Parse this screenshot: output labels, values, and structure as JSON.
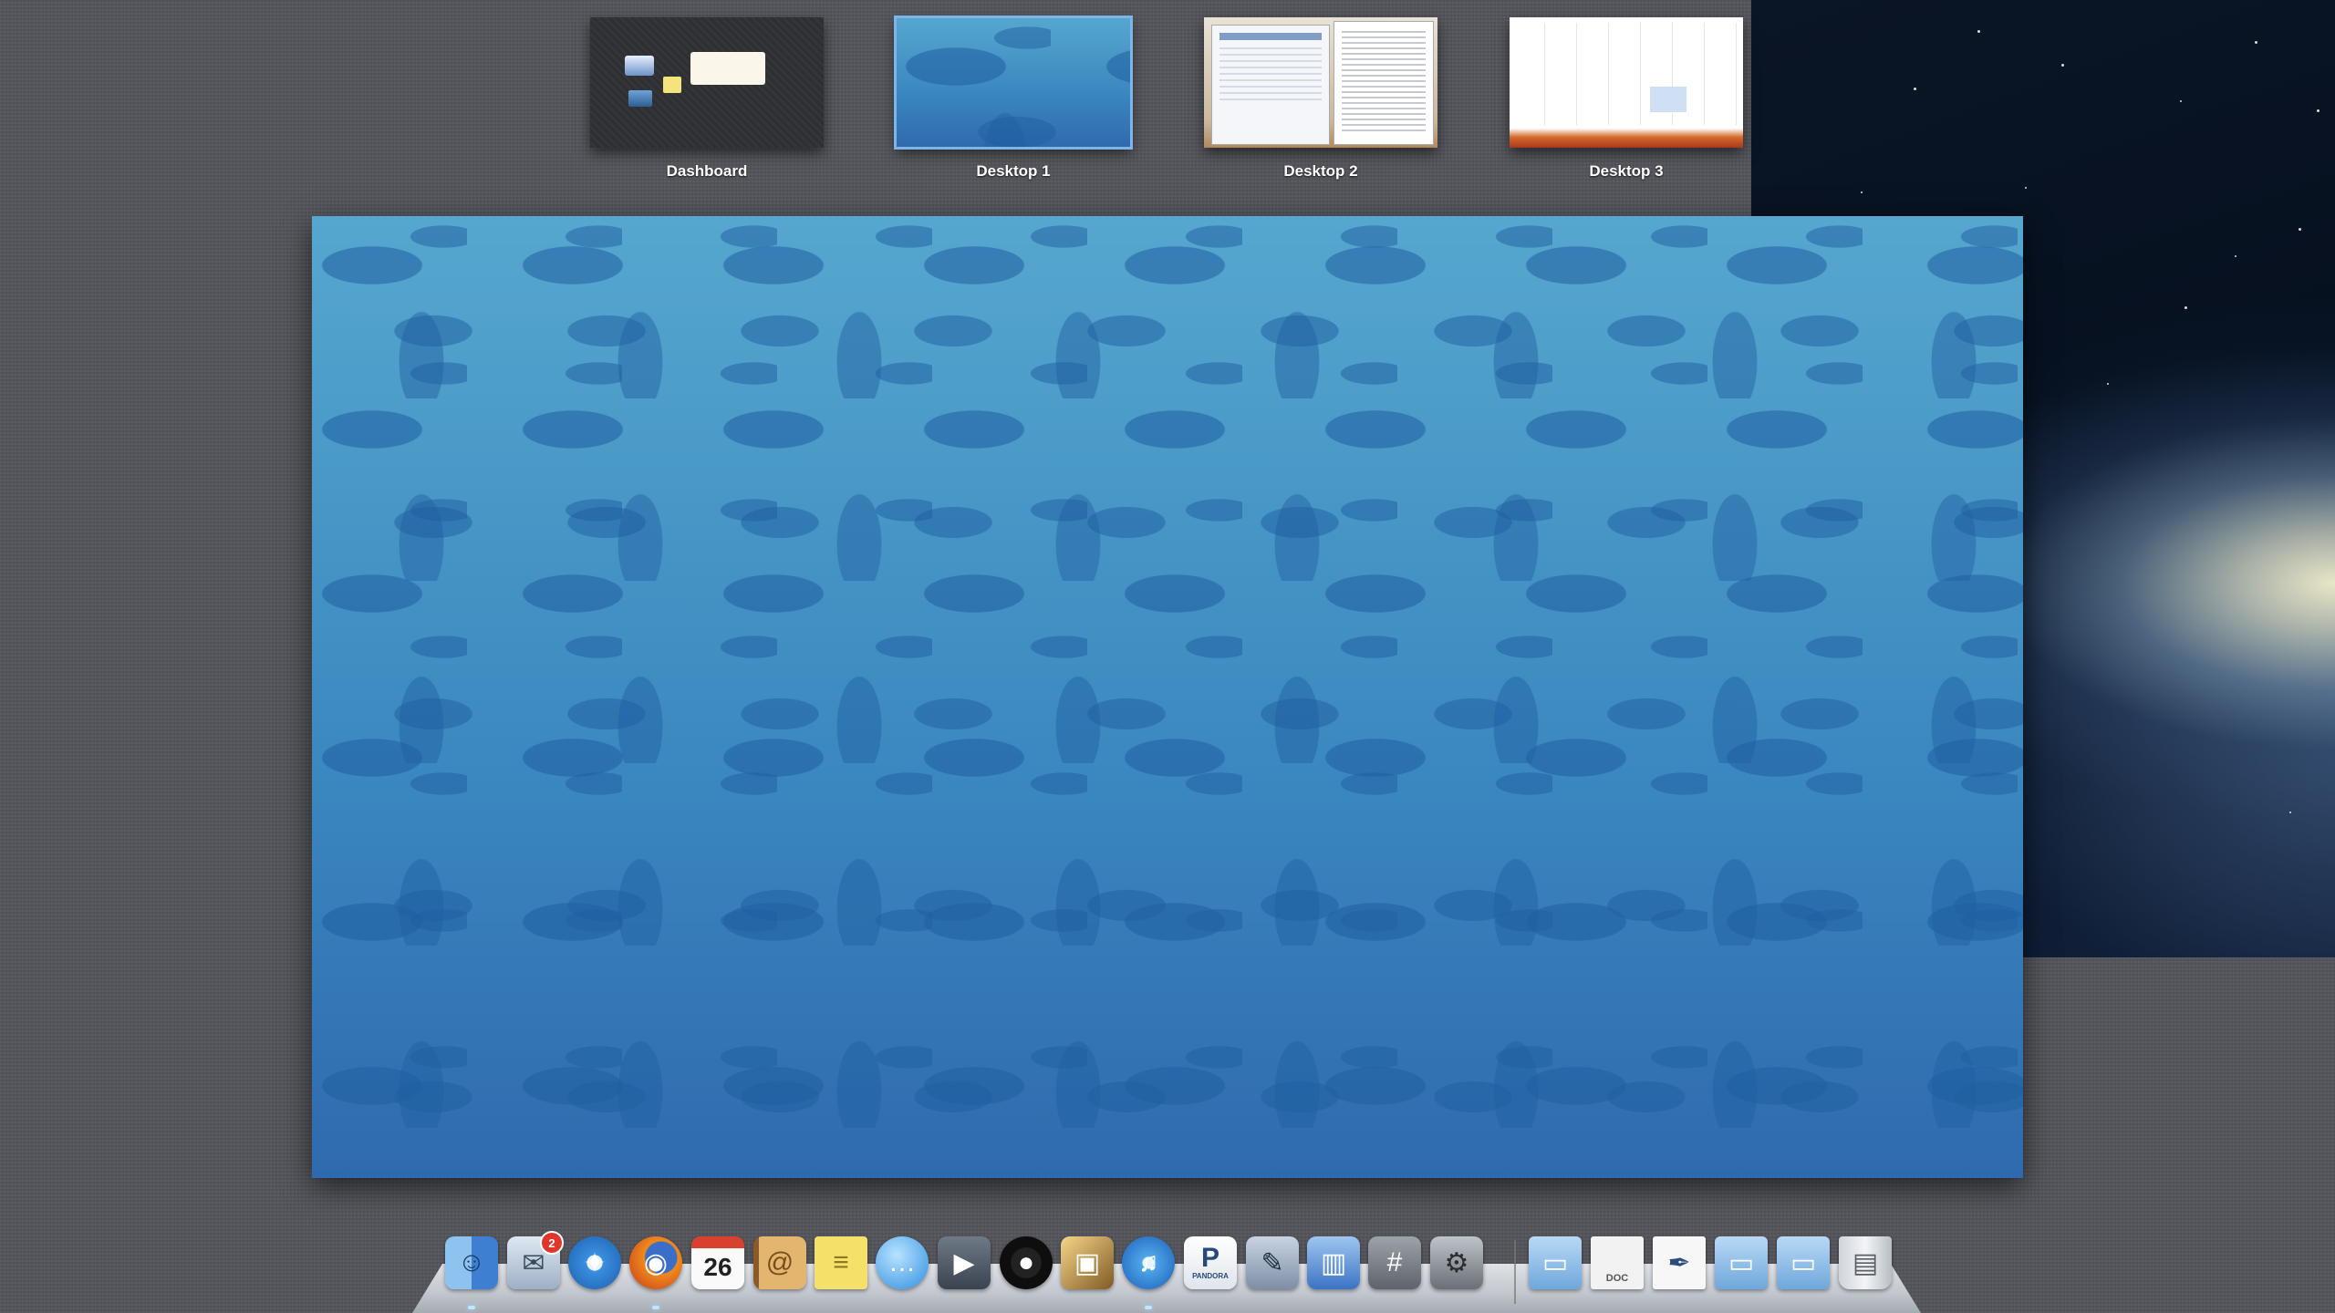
{
  "spaces": {
    "items": [
      {
        "label": "Dashboard"
      },
      {
        "label": "Desktop 1"
      },
      {
        "label": "Desktop 2"
      },
      {
        "label": "Desktop 3"
      }
    ],
    "selected": "Desktop 1"
  },
  "dock": {
    "apps": [
      {
        "icon": "finder-icon"
      },
      {
        "icon": "mail-icon",
        "badge": "2"
      },
      {
        "icon": "safari-icon"
      },
      {
        "icon": "firefox-icon"
      },
      {
        "icon": "calendar-icon",
        "day": "26"
      },
      {
        "icon": "address-book-icon"
      },
      {
        "icon": "stickies-icon"
      },
      {
        "icon": "messages-icon"
      },
      {
        "icon": "facetime-icon"
      },
      {
        "icon": "aperture-icon"
      },
      {
        "icon": "iphoto-icon"
      },
      {
        "icon": "itunes-icon"
      },
      {
        "icon": "pandora-icon",
        "text": "P",
        "sub": "PANDORA"
      },
      {
        "icon": "script-editor-icon"
      },
      {
        "icon": "keynote-icon"
      },
      {
        "icon": "calculator-icon"
      },
      {
        "icon": "system-preferences-icon"
      }
    ],
    "stacks": [
      {
        "icon": "folder-icon"
      },
      {
        "icon": "document-icon",
        "text": "DOC"
      },
      {
        "icon": "text-document-icon"
      },
      {
        "icon": "folder-icon"
      },
      {
        "icon": "folder-icon"
      },
      {
        "icon": "trash-icon"
      }
    ]
  }
}
